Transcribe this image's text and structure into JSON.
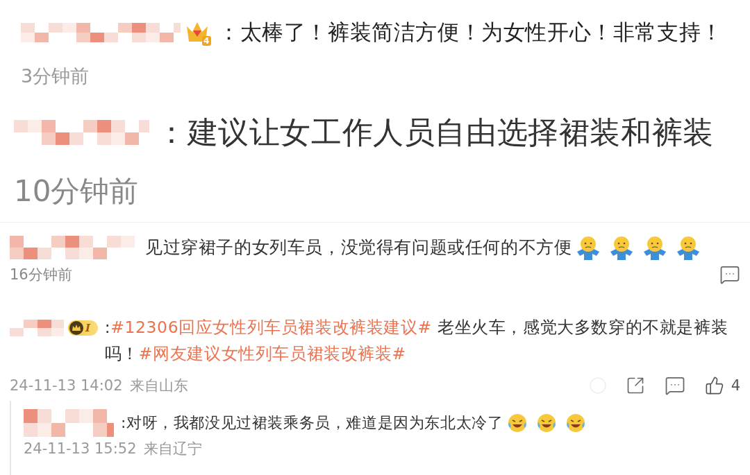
{
  "comments": [
    {
      "badge": {
        "kind": "crown",
        "label": "4"
      },
      "segments": [
        {
          "kind": "text",
          "text": "：太棒了！裤装简洁方便！为女性开心！非常支持！"
        }
      ],
      "time": "3分钟前"
    },
    {
      "segments": [
        {
          "kind": "text",
          "text": "：建议让女工作人员自由选择裙装和裤装"
        }
      ],
      "time": "10分钟前"
    },
    {
      "segments": [
        {
          "kind": "text",
          "text": "见过穿裙子的女列车员，没觉得有问题或任何的不方便"
        }
      ],
      "emojis": [
        {
          "kind": "shrug"
        },
        {
          "kind": "shrug"
        },
        {
          "kind": "shrug"
        },
        {
          "kind": "shrug"
        }
      ],
      "time": "16分钟前",
      "actions": [
        {
          "kind": "comment"
        }
      ]
    },
    {
      "badge": {
        "kind": "pill",
        "label": "I"
      },
      "segments": [
        {
          "kind": "text",
          "text": ":"
        },
        {
          "kind": "hashtag",
          "text": "#12306回应女性列车员裙装改裤装建议#"
        },
        {
          "kind": "text",
          "text": " 老坐火车，感觉大多数穿的不就是裤装吗！"
        },
        {
          "kind": "hashtag",
          "text": "#网友建议女性列车员裙装改裤装#"
        }
      ],
      "time": "24-11-13 14:02",
      "source": "来自山东",
      "actions": [
        {
          "kind": "circle"
        },
        {
          "kind": "share"
        },
        {
          "kind": "comment"
        },
        {
          "kind": "like",
          "count": "4"
        }
      ]
    },
    {
      "segments": [
        {
          "kind": "text",
          "text": ":对呀，我都没见过裙装乘务员，难道是因为东北太冷了"
        }
      ],
      "emojis": [
        {
          "kind": "laugh"
        },
        {
          "kind": "laugh"
        },
        {
          "kind": "laugh"
        }
      ],
      "time": "24-11-13 15:52",
      "source": "来自辽宁"
    }
  ]
}
